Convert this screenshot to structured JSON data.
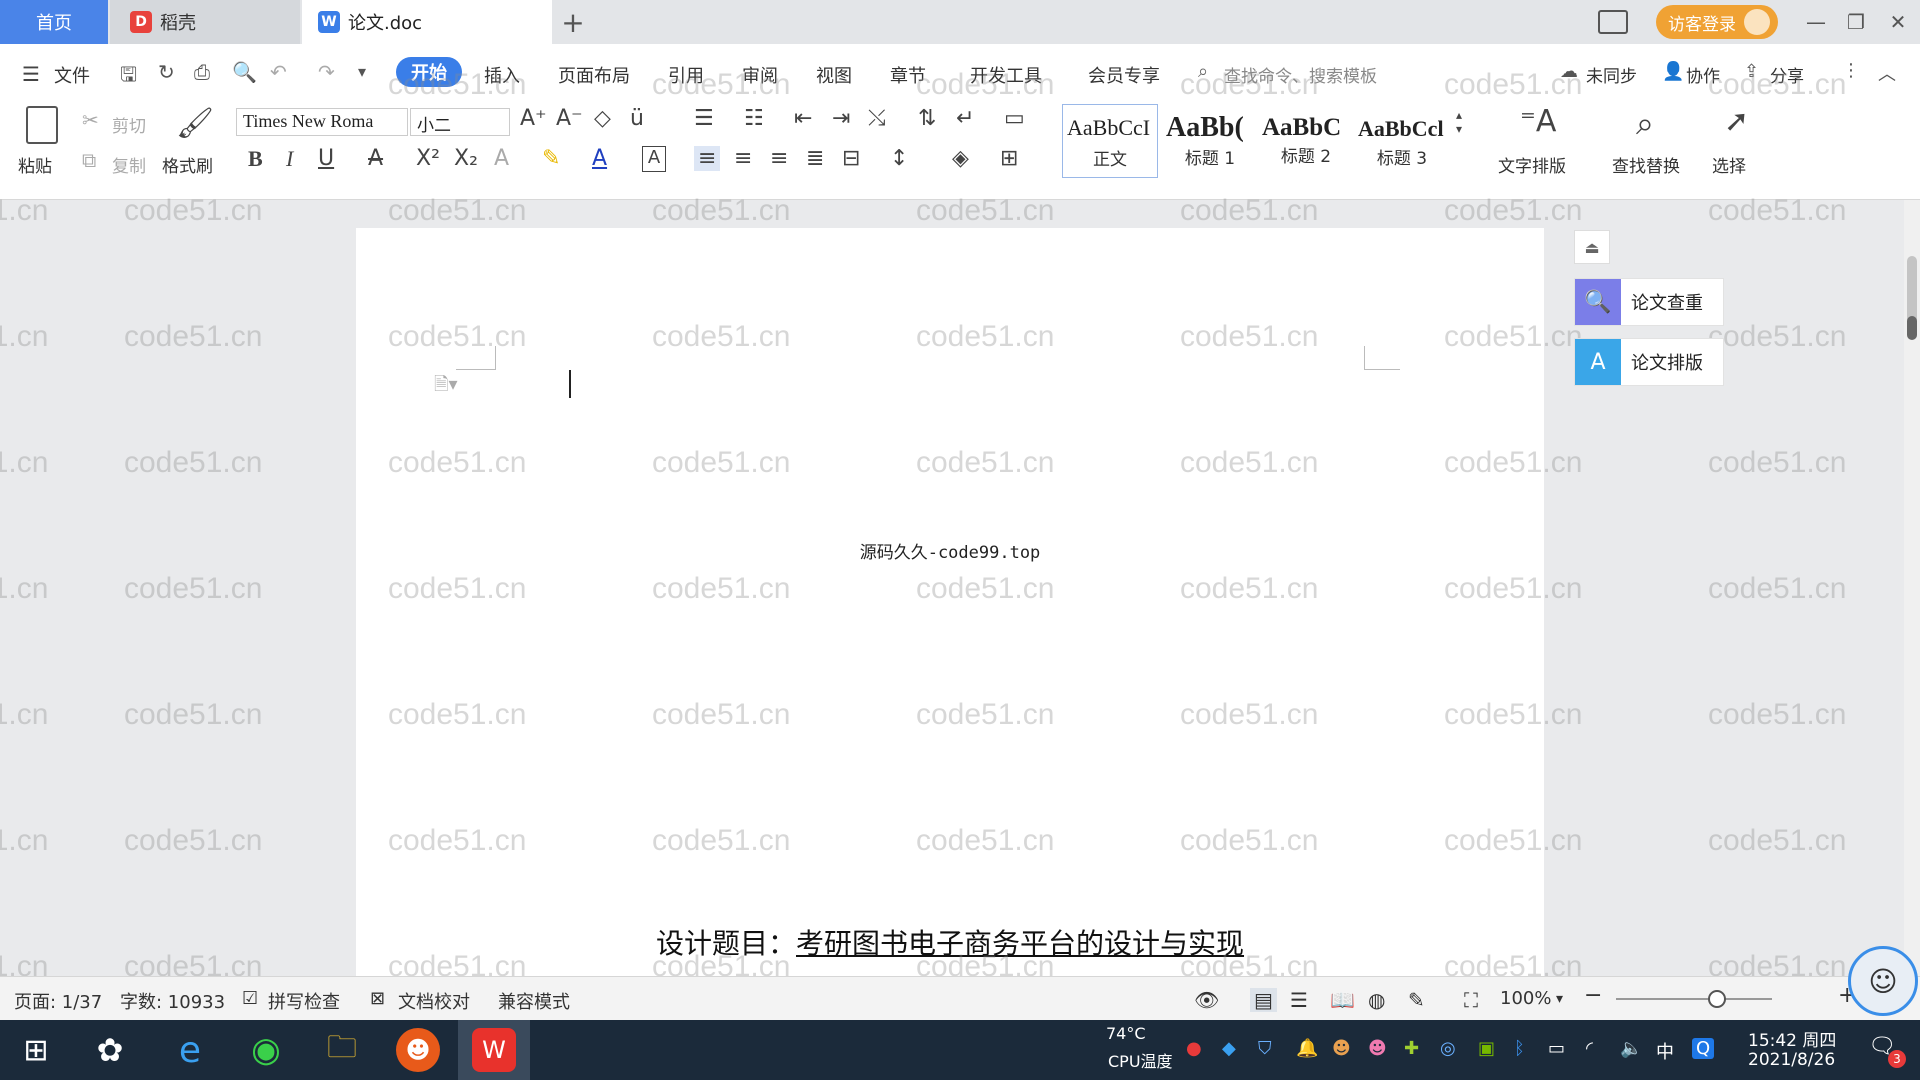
{
  "tabs": {
    "home": "首页",
    "daoke": "稻壳",
    "doc": "论文.doc",
    "add": "+"
  },
  "header": {
    "login": "访客登录"
  },
  "menu": {
    "file": "文件",
    "start": "开始",
    "insert": "插入",
    "layout": "页面布局",
    "reference": "引用",
    "review": "审阅",
    "view": "视图",
    "chapter": "章节",
    "devtools": "开发工具",
    "member": "会员专享",
    "search_placeholder": "查找命令、搜索模板",
    "unsynced": "未同步",
    "collab": "协作",
    "share": "分享"
  },
  "ribbon": {
    "paste": "粘贴",
    "cut": "剪切",
    "copy": "复制",
    "format_painter": "格式刷",
    "font_name": "Times New Roma",
    "font_size": "小二",
    "styles": [
      {
        "sample": "AaBbCcI",
        "label": "正文"
      },
      {
        "sample": "AaBb(",
        "label": "标题 1"
      },
      {
        "sample": "AaBbC",
        "label": "标题 2"
      },
      {
        "sample": "AaBbCcl",
        "label": "标题 3"
      }
    ],
    "text_layout": "文字排版",
    "find_replace": "查找替换",
    "select": "选择"
  },
  "document": {
    "source_line": "源码久久-code99.top",
    "title_prefix": "设计题目：",
    "title_text": "考研图书电子商务平台的设计与实现"
  },
  "side_panel": {
    "check": "论文查重",
    "format": "论文排版"
  },
  "watermark": "code51.cn",
  "statusbar": {
    "page": "页面: 1/37",
    "words": "字数: 10933",
    "spell": "拼写检查",
    "proof": "文档校对",
    "compat": "兼容模式",
    "zoom": "100%"
  },
  "taskbar": {
    "cpu_temp": "74°C",
    "cpu_label": "CPU温度",
    "ime": "中",
    "time": "15:42 周四",
    "date": "2021/8/26"
  },
  "colors": {
    "accent": "#3a7ee8",
    "login": "#f0a234",
    "taskbar": "#1b2a3a"
  }
}
